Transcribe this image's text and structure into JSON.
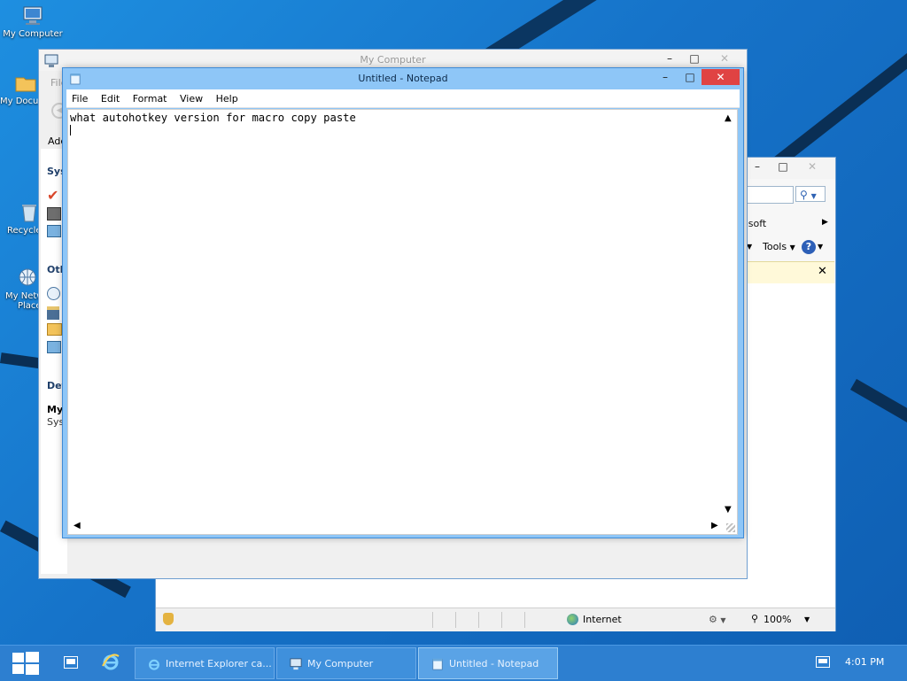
{
  "desktop": {
    "icons": [
      {
        "label": "My Computer",
        "icon": "computer-icon"
      },
      {
        "label": "My Docu",
        "icon": "folder-icon"
      },
      {
        "label": "Recycle",
        "icon": "recycle-bin-icon"
      },
      {
        "label": "My Netw",
        "label2": "Place",
        "icon": "network-icon"
      }
    ]
  },
  "mycomputer": {
    "title": "My Computer",
    "address_partial": "File",
    "address_label": "Add",
    "sections": [
      "Sys",
      "Oth",
      "Det"
    ],
    "details_title": "My",
    "details_sub": "Sys"
  },
  "ie": {
    "link_partial": "osoft",
    "tools_label": "Tools",
    "status_zone": "Internet",
    "zoom": "100%"
  },
  "notepad": {
    "title": "Untitled - Notepad",
    "menu": [
      "File",
      "Edit",
      "Format",
      "View",
      "Help"
    ],
    "content": "what autohotkey version for macro copy paste"
  },
  "taskbar": {
    "buttons": [
      {
        "label": "Internet Explorer ca...",
        "icon": "ie-icon"
      },
      {
        "label": "My Computer",
        "icon": "computer-icon"
      },
      {
        "label": "Untitled - Notepad",
        "icon": "notepad-icon"
      }
    ],
    "clock": "4:01 PM"
  },
  "colors": {
    "close": "#e04343",
    "accent": "#2d7fd0",
    "titlebar_active": "#8ec6f7"
  }
}
